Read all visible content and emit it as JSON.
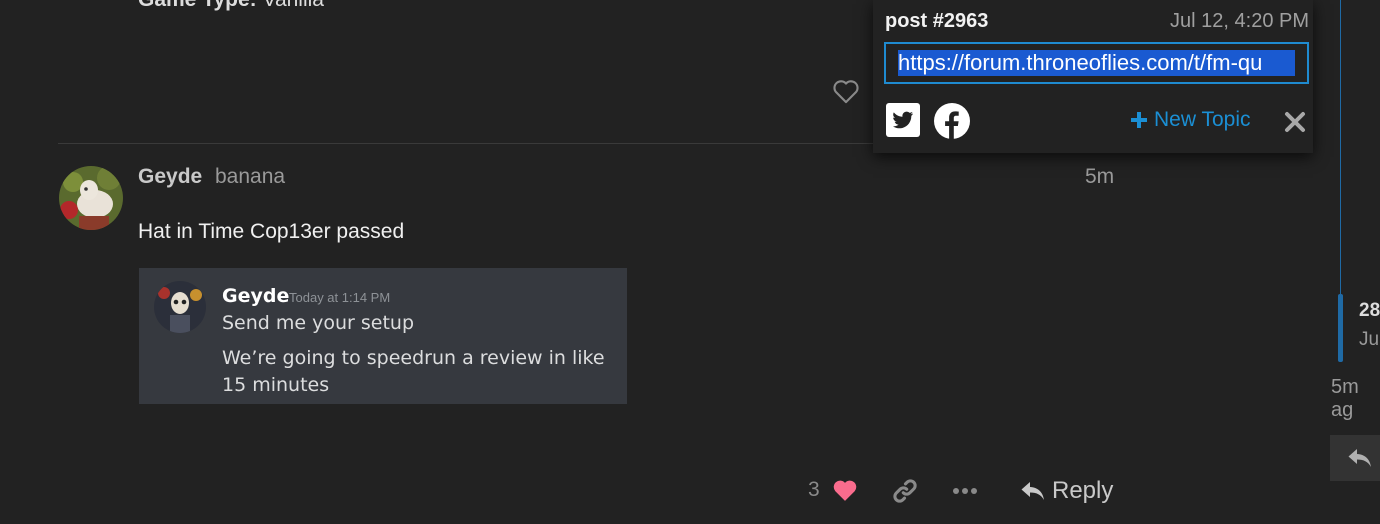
{
  "previous_post": {
    "label": "Game Type:",
    "value": " Vanilla"
  },
  "post": {
    "username": "Geyde",
    "user_title": "banana",
    "age": "5m",
    "text": "Hat in Time Cop13er passed",
    "embed": {
      "author": "Geyde",
      "timestamp": "Today at 1:14 PM",
      "line1": "Send me your setup",
      "line2": "We’re going to speedrun a review in like 15 minutes"
    },
    "actions": {
      "like_count": "3",
      "reply_label": "Reply"
    }
  },
  "share_popup": {
    "title": "post #2963",
    "date": "Jul 12, 4:20 PM",
    "url": "https://forum.throneoflies.com/t/fm-qu",
    "new_topic_label": "New Topic"
  },
  "timeline": {
    "post_number": "28",
    "date": "Ju",
    "ago": "5m ag"
  },
  "colors": {
    "background": "#222222",
    "accent": "#1b8fd4",
    "heart": "#fa6c8d",
    "embed_bg": "#36393f"
  }
}
